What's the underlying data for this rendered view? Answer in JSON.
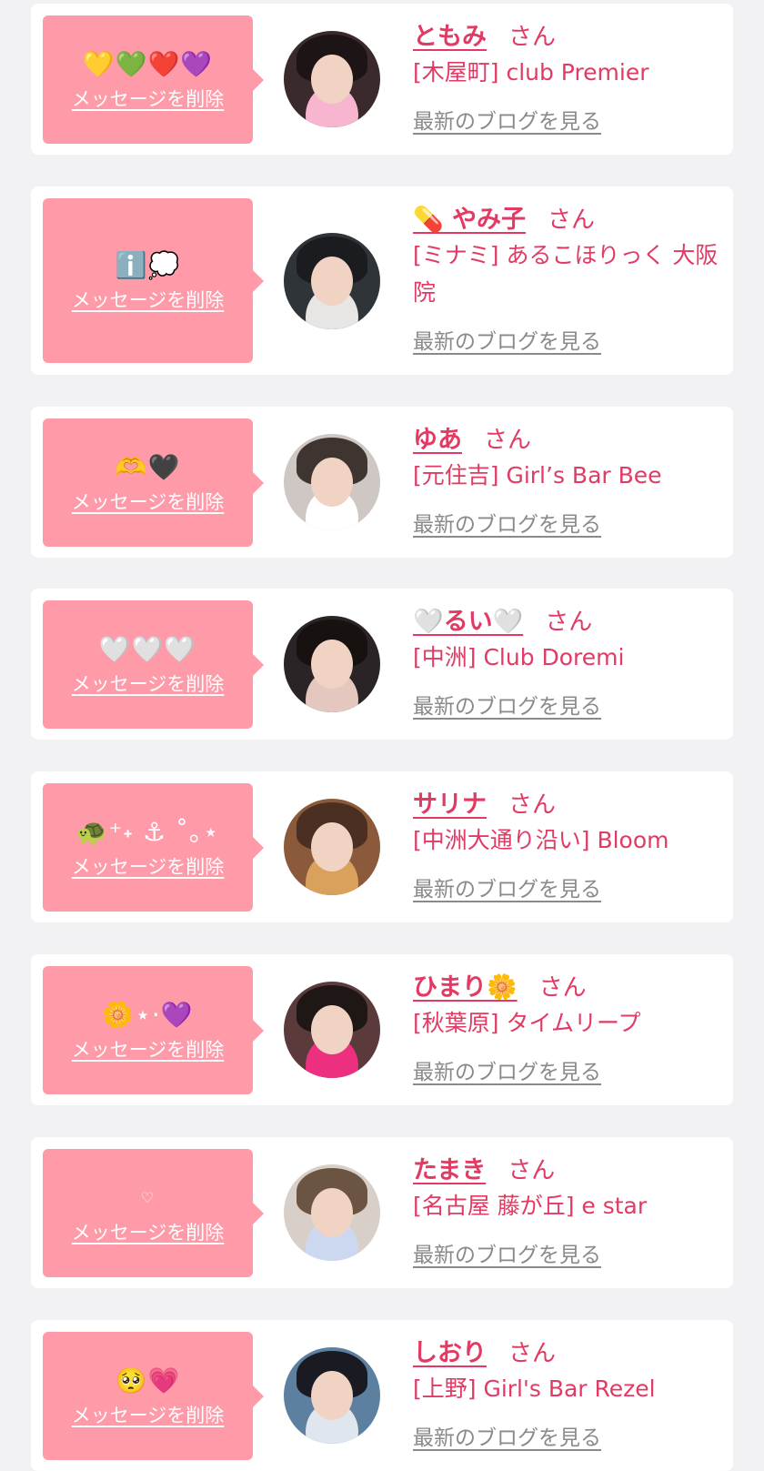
{
  "entries": [
    {
      "message": "💛💚❤️💜",
      "message_small": false,
      "delete_label": "メッセージを削除",
      "name": "ともみ",
      "honorific": "さん",
      "store": "[木屋町] club Premier",
      "blog_label": "最新のブログを見る",
      "avatar_bg": "#3a2a2c",
      "avatar_hair": "#1d1416",
      "avatar_accent": "#f7b5cf"
    },
    {
      "message": "ℹ️💭",
      "message_small": false,
      "delete_label": "メッセージを削除",
      "name": "💊 やみ子",
      "honorific": "さん",
      "store": "[ミナミ] あるこほりっく 大阪院",
      "blog_label": "最新のブログを見る",
      "avatar_bg": "#2f3438",
      "avatar_hair": "#1b1c1f",
      "avatar_accent": "#e8e6e4"
    },
    {
      "message": "🫶🖤",
      "message_small": false,
      "delete_label": "メッセージを削除",
      "name": "ゆあ",
      "honorific": "さん",
      "store": "[元住吉] Girl’s Bar Bee",
      "blog_label": "最新のブログを見る",
      "avatar_bg": "#cfc7c3",
      "avatar_hair": "#3e3531",
      "avatar_accent": "#ffffff"
    },
    {
      "message": "🤍🤍🤍",
      "message_small": false,
      "delete_label": "メッセージを削除",
      "name": "🤍るい🤍",
      "honorific": "さん",
      "store": "[中洲] Club Doremi",
      "blog_label": "最新のブログを見る",
      "avatar_bg": "#2a2426",
      "avatar_hair": "#17120f",
      "avatar_accent": "#e4c8c0"
    },
    {
      "message": "🐢⁺˖ ⚓︎ ˚｡⋆",
      "message_small": false,
      "delete_label": "メッセージを削除",
      "name": "サリナ",
      "honorific": "さん",
      "store": "[中洲大通り沿い] Bloom",
      "blog_label": "最新のブログを見る",
      "avatar_bg": "#8a5a3a",
      "avatar_hair": "#4a2f22",
      "avatar_accent": "#d9a15b"
    },
    {
      "message": "🌼⋆⋅💜",
      "message_small": false,
      "delete_label": "メッセージを削除",
      "name": "ひまり🌼",
      "honorific": "さん",
      "store": "[秋葉原] タイムリープ",
      "blog_label": "最新のブログを見る",
      "avatar_bg": "#5a3a3a",
      "avatar_hair": "#1f1616",
      "avatar_accent": "#ec2f7f"
    },
    {
      "message": "♡",
      "message_small": true,
      "delete_label": "メッセージを削除",
      "name": "たまき",
      "honorific": "さん",
      "store": "[名古屋 藤が丘] e star",
      "blog_label": "最新のブログを見る",
      "avatar_bg": "#d8d0c8",
      "avatar_hair": "#6b5442",
      "avatar_accent": "#cbd8f0"
    },
    {
      "message": "🥺💗",
      "message_small": false,
      "delete_label": "メッセージを削除",
      "name": "しおり",
      "honorific": "さん",
      "store": "[上野] Girl's Bar Rezel",
      "blog_label": "最新のブログを見る",
      "avatar_bg": "#5d7fa0",
      "avatar_hair": "#1a1a22",
      "avatar_accent": "#dfe6ee"
    }
  ]
}
